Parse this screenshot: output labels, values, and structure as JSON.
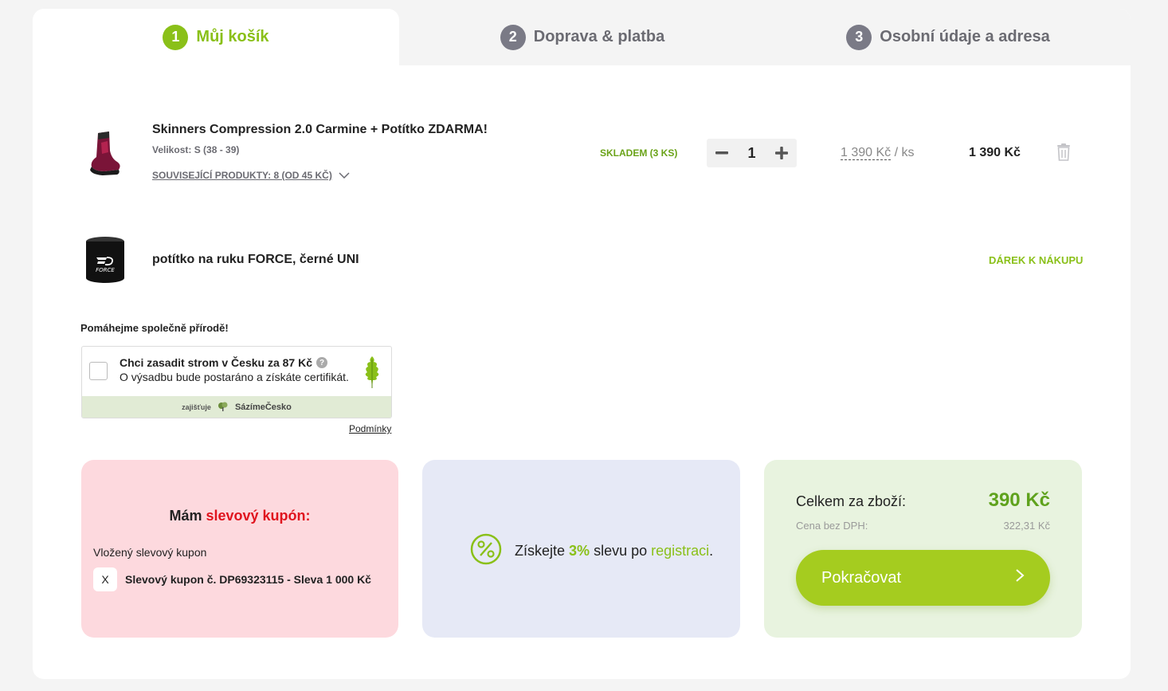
{
  "steps": [
    {
      "num": "1",
      "label": "Můj košík"
    },
    {
      "num": "2",
      "label": "Doprava & platba"
    },
    {
      "num": "3",
      "label": "Osobní údaje a adresa"
    }
  ],
  "product": {
    "title": "Skinners Compression 2.0 Carmine + Potítko ZDARMA!",
    "size": "Velikost: S (38 - 39)",
    "related": "SOUVISEJÍCÍ PRODUKTY: 8 (OD 45 KČ)",
    "stock": "SKLADEM (3 KS)",
    "quantity": "1",
    "unit_price": "1 390 Kč",
    "unit_suffix": "/ ks",
    "total": "1 390 Kč"
  },
  "gift": {
    "title": "potítko na ruku FORCE, černé UNI",
    "label": "DÁREK K NÁKUPU",
    "logo_text": "FORCE"
  },
  "eco": {
    "heading": "Pomáhejme společně přírodě!",
    "line1": "Chci zasadit strom v Česku za 87 Kč",
    "line2": "O výsadbu bude postaráno a získáte certifikát.",
    "footer_prefix": "zajišťuje",
    "footer_brand": "SázímeČesko",
    "terms": "Podmínky"
  },
  "coupon": {
    "heading_prefix": "Mám",
    "heading_highlight": "slevový kupón:",
    "inserted_label": "Vložený slevový kupon",
    "remove": "X",
    "value": "Slevový kupon č. DP69323115 - Sleva 1 000 Kč"
  },
  "registration": {
    "prefix": "Získejte",
    "percent": "3%",
    "middle": "slevu po",
    "link": "registraci",
    "suffix": "."
  },
  "summary": {
    "total_label": "Celkem za zboží:",
    "total_value": "390 Kč",
    "vat_label": "Cena bez DPH:",
    "vat_value": "322,31 Kč",
    "continue": "Pokračovat"
  },
  "colors": {
    "accent_green": "#8ac019",
    "button_green": "#a5cc1f",
    "coupon_red": "#e0141e"
  }
}
